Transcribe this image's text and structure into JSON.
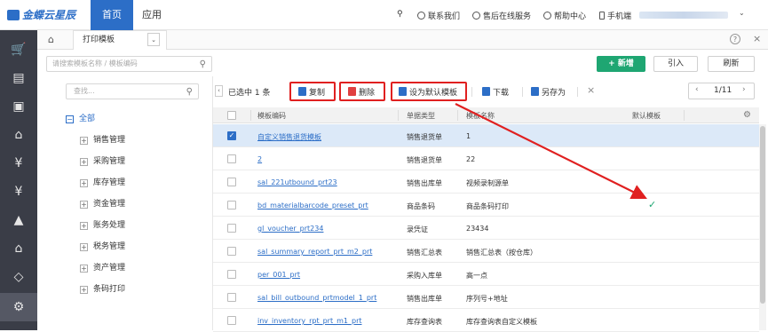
{
  "app": {
    "logo_text": "金蝶云星辰"
  },
  "topnav": {
    "tab_home": "首页",
    "tab_app": "应用",
    "contact": "联系我们",
    "service": "售后在线服务",
    "help": "帮助中心",
    "mobile": "手机端"
  },
  "tabs": {
    "current": "打印模板"
  },
  "list": {
    "search_placeholder": "请搜索模板名称 / 模板编码",
    "new_label": "+ 新增",
    "import_label": "引入",
    "refresh_label": "刷新"
  },
  "tree": {
    "search_placeholder": "查找...",
    "root": "全部",
    "items": [
      "销售管理",
      "采购管理",
      "库存管理",
      "资金管理",
      "账务处理",
      "税务管理",
      "资产管理",
      "条码打印"
    ]
  },
  "toolbar": {
    "selected": "已选中 1 条",
    "copy": "复制",
    "delete": "删除",
    "set_default": "设为默认模板",
    "download": "下载",
    "save_as": "另存为",
    "clear": "×",
    "page": "1/11"
  },
  "table": {
    "columns": [
      "模板编码",
      "单据类型",
      "模板名称",
      "默认模板"
    ],
    "rows": [
      {
        "code": "自定义销售退货模板",
        "type": "销售退货单",
        "name": "1",
        "default": false,
        "selected": true
      },
      {
        "code": "2",
        "type": "销售退货单",
        "name": "22",
        "default": false,
        "selected": false
      },
      {
        "code": "sal_221utbound_prt23",
        "type": "销售出库单",
        "name": "视频录制源单",
        "default": false,
        "selected": false
      },
      {
        "code": "bd_materialbarcode_preset_prt",
        "type": "商品条码",
        "name": "商品条码打印",
        "default": true,
        "selected": false
      },
      {
        "code": "gl_voucher_prt234",
        "type": "录凭证",
        "name": "23434",
        "default": false,
        "selected": false
      },
      {
        "code": "sal_summary_report_prt_m2_prt",
        "type": "销售汇总表",
        "name": "销售汇总表（按仓库）",
        "default": false,
        "selected": false
      },
      {
        "code": "per_001_prt",
        "type": "采购入库单",
        "name": "高一点",
        "default": false,
        "selected": false
      },
      {
        "code": "sal_bill_outbound_prtmodel_1_prt",
        "type": "销售出库单",
        "name": "序列号+地址",
        "default": false,
        "selected": false
      },
      {
        "code": "inv_inventory_rpt_prt_m1_prt",
        "type": "库存查询表",
        "name": "库存查询表自定义模板",
        "default": false,
        "selected": false
      }
    ]
  },
  "colors": {
    "accent": "#2c6ec7",
    "green": "#1ea672",
    "annotation": "#e02020",
    "sidebar": "#3a3d47"
  }
}
